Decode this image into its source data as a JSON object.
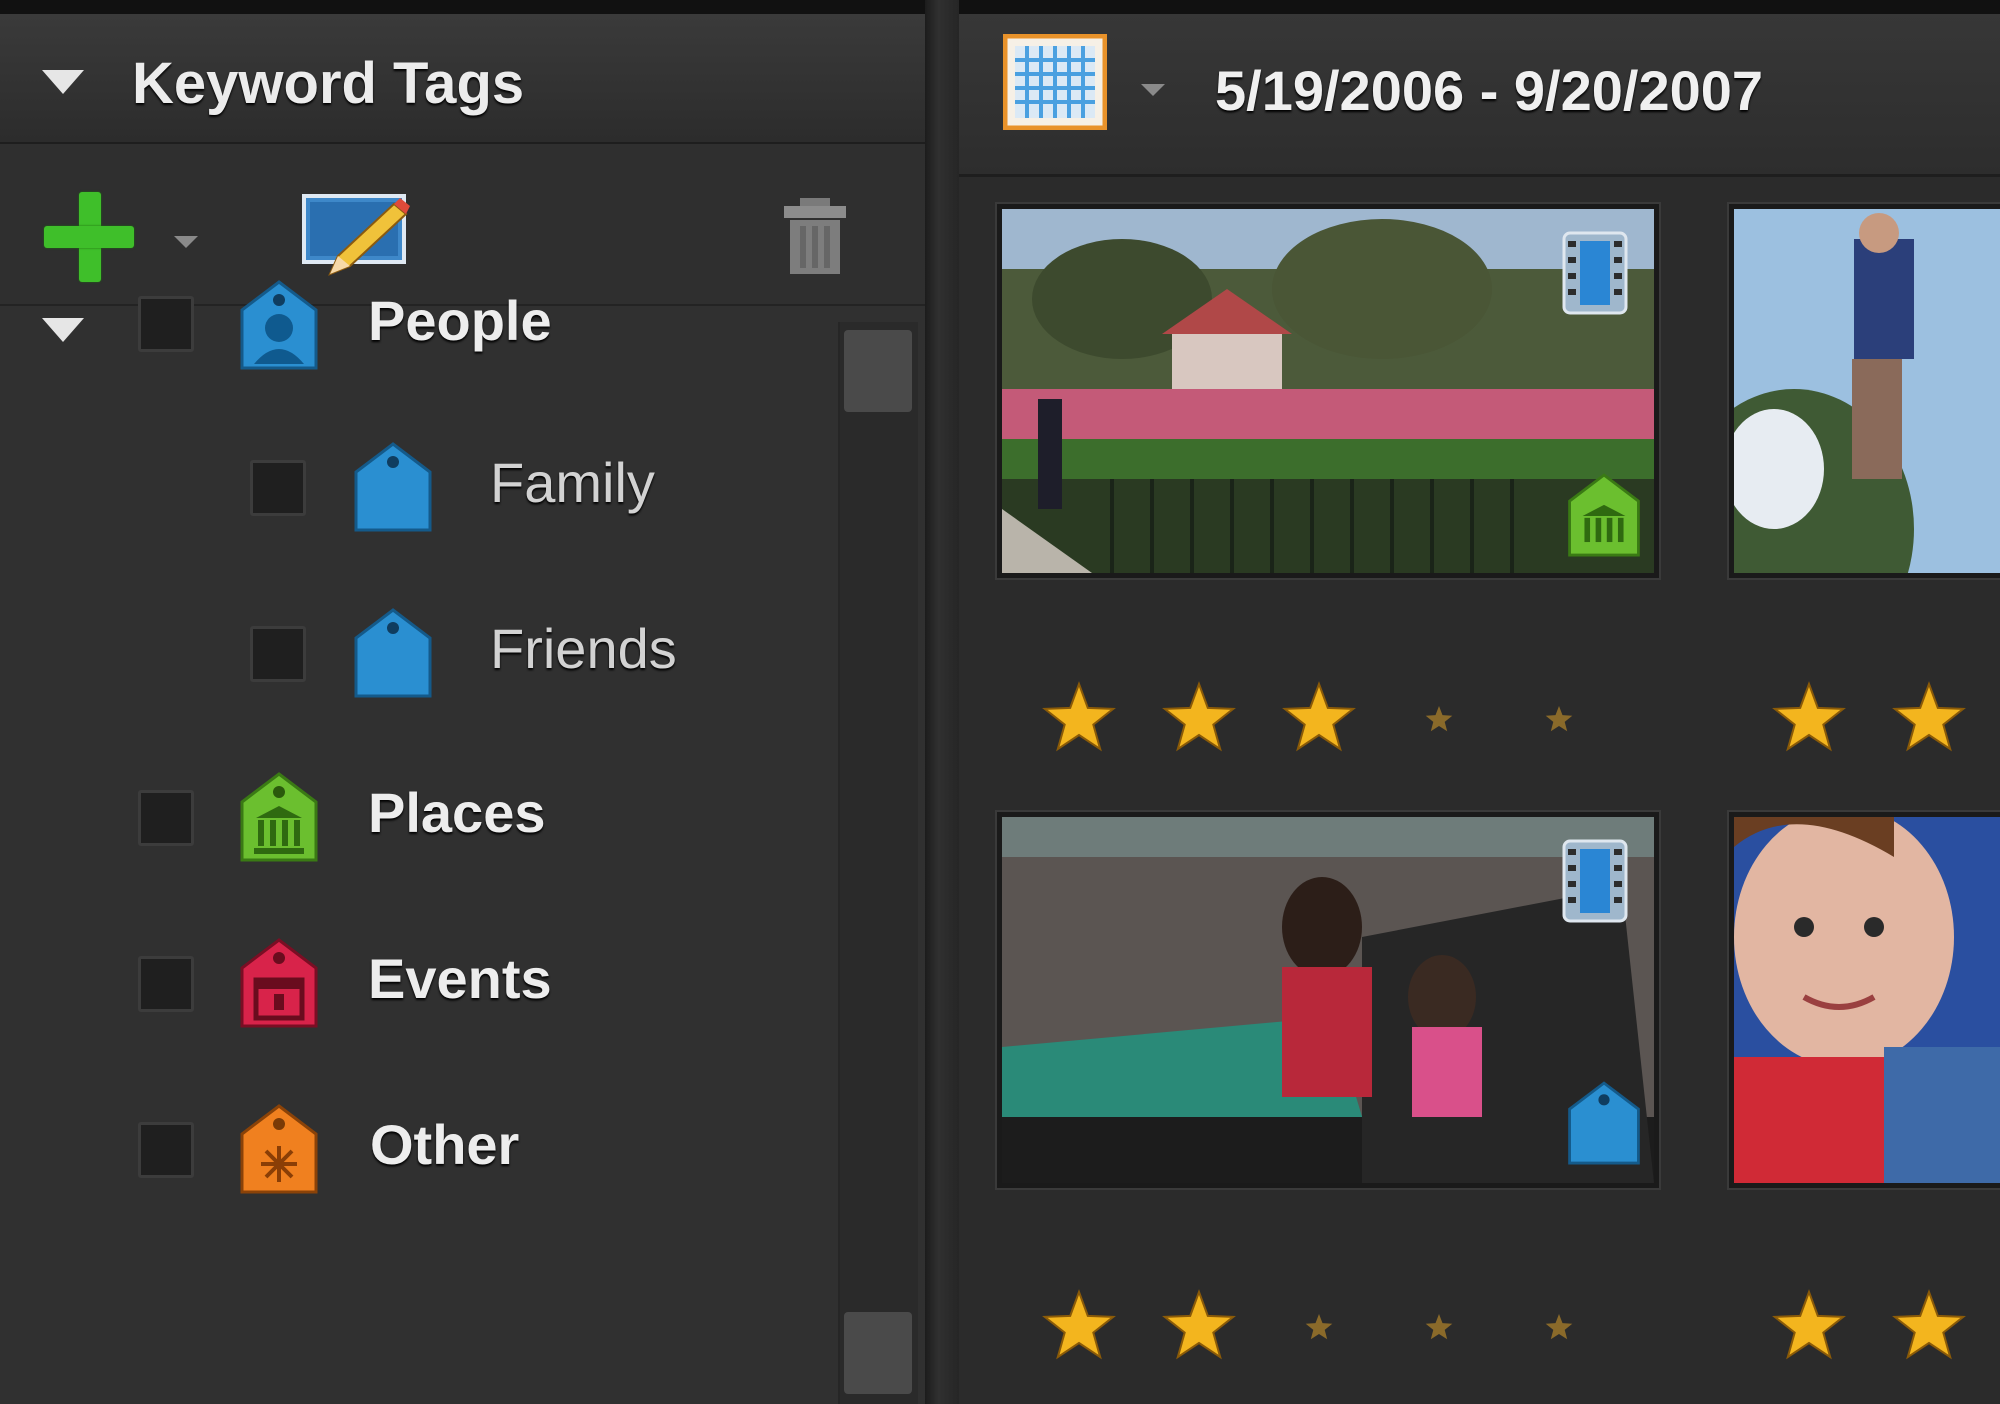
{
  "left_panel": {
    "title": "Keyword Tags",
    "toolbar": {
      "new_label": "",
      "edit_label": "",
      "delete_label": ""
    },
    "tree": [
      {
        "label": "People",
        "level": 0,
        "expanded": true,
        "checked": false,
        "color": "#2a8fd1",
        "icon": "people-tag-icon"
      },
      {
        "label": "Family",
        "level": 1,
        "checked": false,
        "color": "#2a8fd1",
        "icon": "tag-icon"
      },
      {
        "label": "Friends",
        "level": 1,
        "checked": false,
        "color": "#2a8fd1",
        "icon": "tag-icon"
      },
      {
        "label": "Places",
        "level": 0,
        "checked": false,
        "color": "#6bbf2f",
        "icon": "places-tag-icon"
      },
      {
        "label": "Events",
        "level": 0,
        "checked": false,
        "color": "#d8234a",
        "icon": "events-tag-icon"
      },
      {
        "label": "Other",
        "level": 0,
        "checked": false,
        "color": "#f0801f",
        "icon": "other-tag-icon"
      }
    ]
  },
  "browser": {
    "date_range": "5/19/2006 - 9/20/2007",
    "thumbnails": [
      {
        "type": "video",
        "tag": "places-tag",
        "rating": 3,
        "max_rating": 5
      },
      {
        "type": "photo",
        "tag": null,
        "rating": 2,
        "max_rating": 5
      },
      {
        "type": "video",
        "tag": "people-tag",
        "rating": 2,
        "max_rating": 5
      },
      {
        "type": "photo",
        "tag": null,
        "rating": 2,
        "max_rating": 5
      }
    ]
  },
  "colors": {
    "accent_star": "#f3b51e",
    "panel_bg": "#303030",
    "people_tag": "#2a8fd1",
    "places_tag": "#6bbf2f",
    "events_tag": "#d8234a",
    "other_tag": "#f0801f"
  }
}
